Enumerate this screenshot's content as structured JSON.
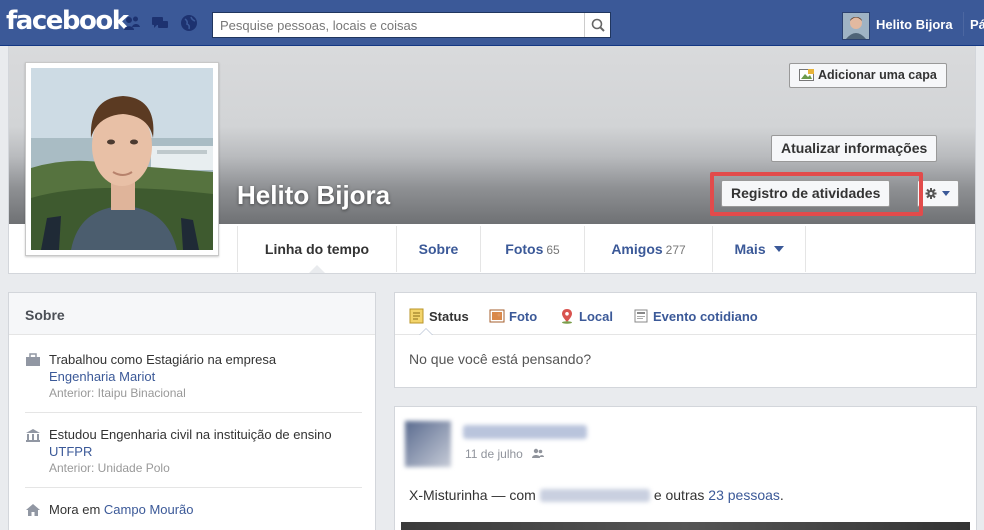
{
  "topbar": {
    "logo": "facebook",
    "search_placeholder": "Pesquise pessoas, locais e coisas",
    "user_name": "Helito Bijora",
    "truncated_link": "Pá"
  },
  "profile": {
    "name": "Helito Bijora",
    "buttons": {
      "add_cover": "Adicionar uma capa",
      "update_info": "Atualizar informações",
      "activity_log": "Registro de atividades"
    },
    "tabs": [
      {
        "label": "Linha do tempo",
        "count": ""
      },
      {
        "label": "Sobre",
        "count": ""
      },
      {
        "label": "Fotos",
        "count": "65"
      },
      {
        "label": "Amigos",
        "count": "277"
      },
      {
        "label": "Mais",
        "count": ""
      }
    ]
  },
  "about": {
    "title": "Sobre",
    "work": {
      "text": "Trabalhou como Estagiário na empresa",
      "link": "Engenharia Mariot",
      "sub": "Anterior: Itaipu Binacional"
    },
    "education": {
      "text": "Estudou Engenharia civil na instituição de ensino",
      "link": "UTFPR",
      "sub": "Anterior: Unidade Polo"
    },
    "home": {
      "text": "Mora em",
      "link": "Campo Mourão"
    }
  },
  "composer": {
    "tabs": [
      "Status",
      "Foto",
      "Local",
      "Evento cotidiano"
    ],
    "placeholder": "No que você está pensando?"
  },
  "post": {
    "date": "11 de julho",
    "text_prefix": "X-Misturinha — com",
    "text_middle": "e outras",
    "text_link": "23 pessoas",
    "text_end": "."
  },
  "colors": {
    "brand": "#3b5998",
    "highlight": "#e24b4b"
  }
}
